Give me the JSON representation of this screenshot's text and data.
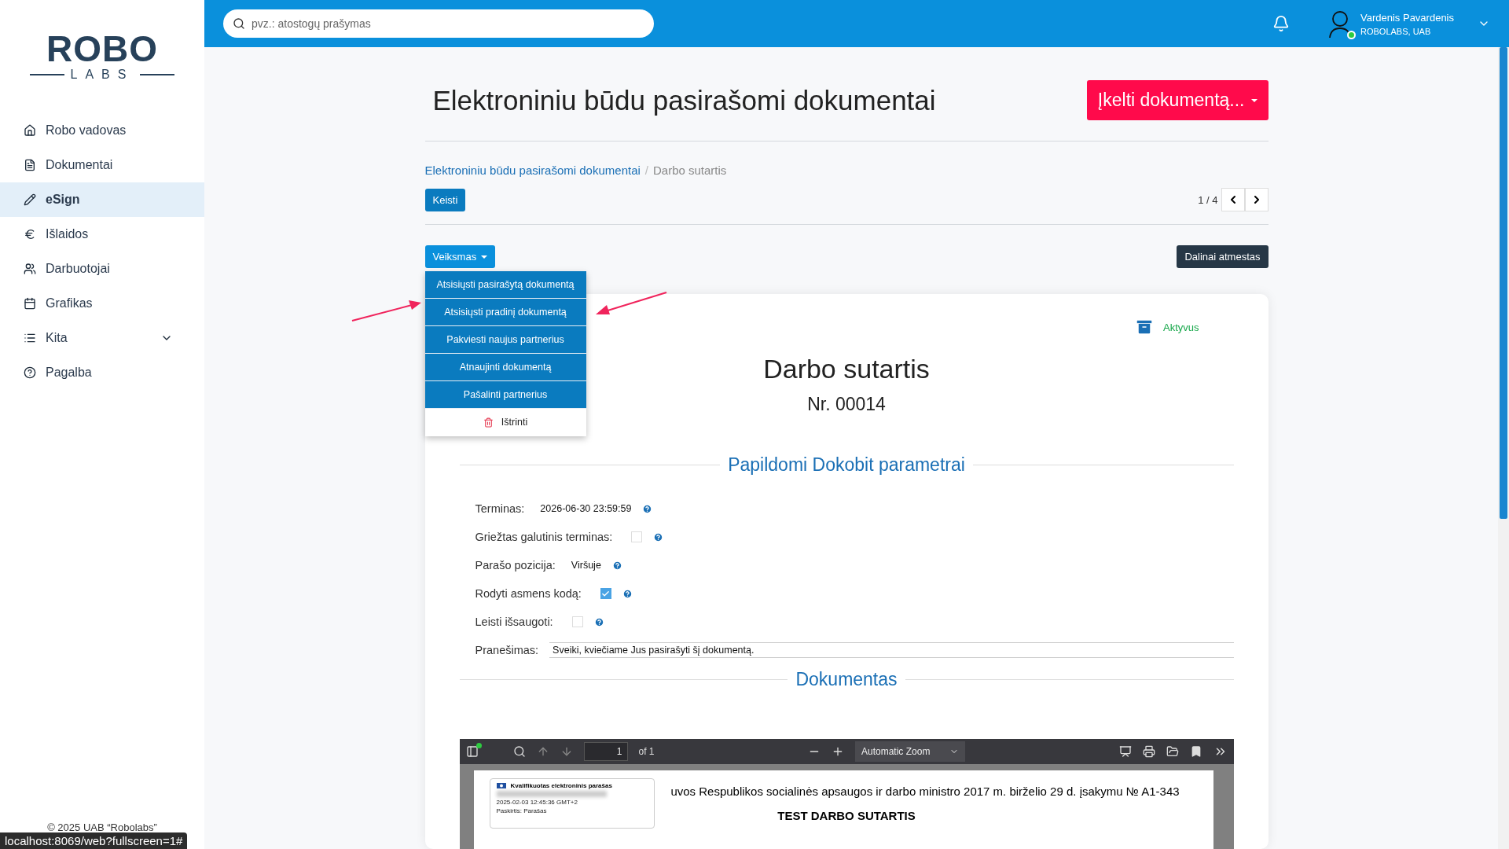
{
  "sidebar": {
    "logo": {
      "top": "ROBO",
      "bottom": "LABS"
    },
    "items": [
      {
        "label": "Robo vadovas",
        "kind": "link",
        "selected": false
      },
      {
        "label": "Dokumentai",
        "kind": "link",
        "selected": false
      },
      {
        "label": "eSign",
        "kind": "link",
        "selected": true
      },
      {
        "label": "Išlaidos",
        "kind": "link",
        "selected": false
      },
      {
        "label": "Darbuotojai",
        "kind": "link",
        "selected": false
      },
      {
        "label": "Grafikas",
        "kind": "link",
        "selected": false
      },
      {
        "label": "Kita",
        "kind": "group",
        "selected": false
      },
      {
        "label": "Pagalba",
        "kind": "link",
        "selected": false
      }
    ],
    "footer": "© 2025 UAB “Robolabs”"
  },
  "topbar": {
    "search": {
      "placeholder": "pvz.: atostogų prašymas"
    },
    "user": {
      "name": "Vardenis Pavardenis",
      "company": "ROBOLABS, UAB",
      "online": true
    }
  },
  "page": {
    "title": "Elektroniniu būdu pasirašomi dokumentai",
    "upload_button": "Įkelti dokumentą...",
    "breadcrumb_separator": "/",
    "breadcrumb": [
      {
        "label": "Elektroniniu būdu pasirašomi dokumentai",
        "kind": "link"
      },
      {
        "label": "Darbo sutartis",
        "kind": "current"
      }
    ],
    "edit_button": "Keisti",
    "pager": "1 / 4",
    "action_button": "Veiksmas",
    "status_button": "Dalinai atmestas",
    "action_menu": [
      {
        "label": "Atsisiųsti pasirašytą dokumentą",
        "kind": "action"
      },
      {
        "label": "Atsisiųsti pradinį dokumentą",
        "kind": "action"
      },
      {
        "label": "Pakviesti naujus partnerius",
        "kind": "action"
      },
      {
        "label": "Atnaujinti dokumentą",
        "kind": "action"
      },
      {
        "label": "Pašalinti partnerius",
        "kind": "action"
      },
      {
        "label": "Ištrinti",
        "kind": "delete"
      }
    ]
  },
  "document": {
    "state": "Aktyvus",
    "title": "Darbo sutartis",
    "number": "Nr. 00014",
    "params_heading": "Papildomi Dokobit parametrai",
    "params": [
      {
        "label": "Terminas:",
        "kind": "text",
        "value": "2026-06-30 23:59:59"
      },
      {
        "label": "Griežtas galutinis terminas:",
        "kind": "checkbox",
        "checked": false
      },
      {
        "label": "Parašo pozicija:",
        "kind": "text",
        "value": "Viršuje"
      },
      {
        "label": "Rodyti asmens kodą:",
        "kind": "checkbox",
        "checked": true
      },
      {
        "label": "Leisti išsaugoti:",
        "kind": "checkbox",
        "checked": false
      },
      {
        "label": "Pranešimas:",
        "kind": "input",
        "value": "Sveiki, kviečiame Jus pasirašyti šį dokumentą."
      }
    ],
    "document_heading": "Dokumentas",
    "viewer": {
      "page_number": "1",
      "page_count": "of 1",
      "zoom": "Automatic Zoom",
      "stamp": {
        "title": "Kvalifikuotas elektroninis parašas",
        "date": "2025-02-03 12:45:36 GMT+2",
        "purpose": "Paskirtis: Parašas"
      },
      "lines": [
        {
          "text": "uvos Respublikos socialinės apsaugos ir darbo ministro 2017 m. birželio 29 d. įsakymu № A1-343",
          "kind": "normal"
        },
        {
          "text": "TEST DARBO SUTARTIS",
          "kind": "heading"
        }
      ]
    }
  },
  "status_bar": "localhost:8069/web?fullscreen=1#"
}
